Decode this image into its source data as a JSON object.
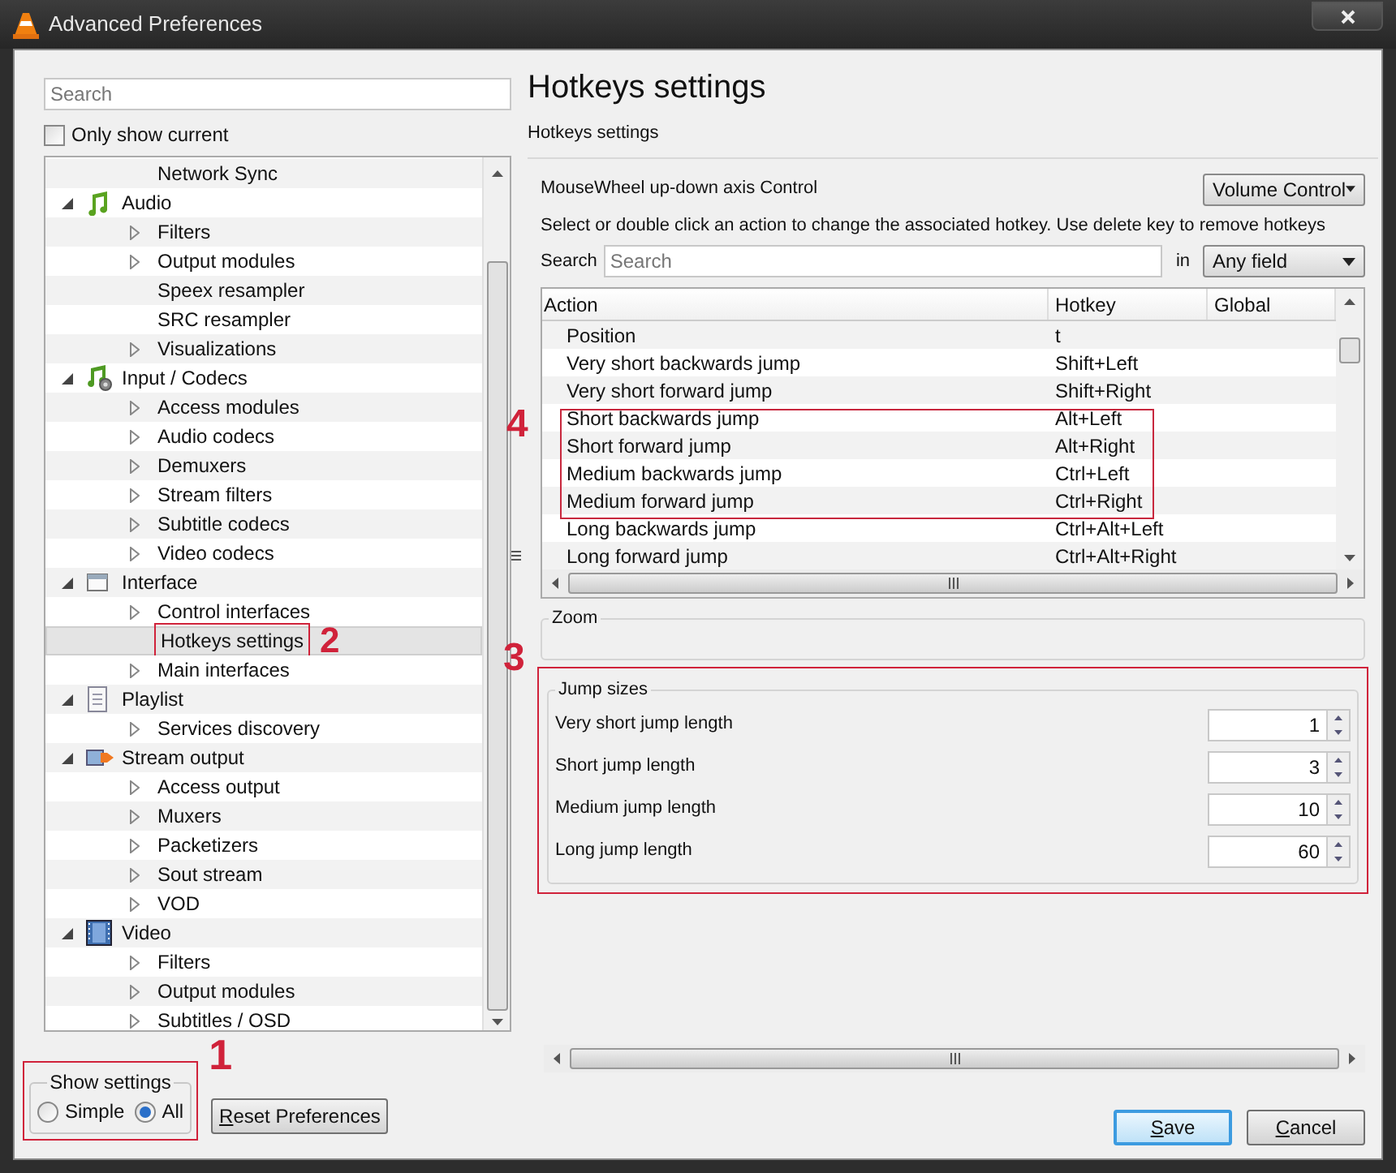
{
  "window": {
    "title": "Advanced Preferences"
  },
  "search": {
    "placeholder": "Search"
  },
  "only_show_current": {
    "label": "Only show current",
    "checked": false
  },
  "tree": {
    "continued_children": [
      {
        "label": "Network Sync",
        "expandable": false,
        "selected": false
      }
    ],
    "items": [
      {
        "label": "Audio",
        "kind": "audio",
        "expanded": true,
        "children": [
          {
            "label": "Filters",
            "expandable": true,
            "selected": false
          },
          {
            "label": "Output modules",
            "expandable": true,
            "selected": false
          },
          {
            "label": "Speex resampler",
            "expandable": false,
            "selected": false
          },
          {
            "label": "SRC resampler",
            "expandable": false,
            "selected": false
          },
          {
            "label": "Visualizations",
            "expandable": true,
            "selected": false
          }
        ]
      },
      {
        "label": "Input / Codecs",
        "kind": "codecs",
        "expanded": true,
        "children": [
          {
            "label": "Access modules",
            "expandable": true,
            "selected": false
          },
          {
            "label": "Audio codecs",
            "expandable": true,
            "selected": false
          },
          {
            "label": "Demuxers",
            "expandable": true,
            "selected": false
          },
          {
            "label": "Stream filters",
            "expandable": true,
            "selected": false
          },
          {
            "label": "Subtitle codecs",
            "expandable": true,
            "selected": false
          },
          {
            "label": "Video codecs",
            "expandable": true,
            "selected": false
          }
        ]
      },
      {
        "label": "Interface",
        "kind": "interface",
        "expanded": true,
        "children": [
          {
            "label": "Control interfaces",
            "expandable": true,
            "selected": false
          },
          {
            "label": "Hotkeys settings",
            "expandable": false,
            "selected": true,
            "annotation": "2"
          },
          {
            "label": "Main interfaces",
            "expandable": true,
            "selected": false
          }
        ]
      },
      {
        "label": "Playlist",
        "kind": "playlist",
        "expanded": true,
        "children": [
          {
            "label": "Services discovery",
            "expandable": true,
            "selected": false
          }
        ]
      },
      {
        "label": "Stream output",
        "kind": "stream",
        "expanded": true,
        "children": [
          {
            "label": "Access output",
            "expandable": true,
            "selected": false
          },
          {
            "label": "Muxers",
            "expandable": true,
            "selected": false
          },
          {
            "label": "Packetizers",
            "expandable": true,
            "selected": false
          },
          {
            "label": "Sout stream",
            "expandable": true,
            "selected": false
          },
          {
            "label": "VOD",
            "expandable": true,
            "selected": false
          }
        ]
      },
      {
        "label": "Video",
        "kind": "video",
        "expanded": true,
        "children": [
          {
            "label": "Filters",
            "expandable": true,
            "selected": false
          },
          {
            "label": "Output modules",
            "expandable": true,
            "selected": false
          },
          {
            "label": "Subtitles / OSD",
            "expandable": true,
            "selected": false
          }
        ]
      }
    ]
  },
  "show_settings": {
    "title": "Show settings",
    "annotation": "1",
    "options": [
      {
        "label": "Simple",
        "selected": false
      },
      {
        "label": "All",
        "selected": true
      }
    ]
  },
  "reset_button": "Reset Preferences",
  "page_title": "Hotkeys settings",
  "section_title": "Hotkeys settings",
  "mousewheel": {
    "label": "MouseWheel up-down axis Control",
    "value": "Volume Control"
  },
  "instructions": "Select or double click an action to change the associated hotkey. Use delete key to remove hotkeys",
  "hotkey_search": {
    "label": "Search",
    "placeholder": "Search",
    "in_label": "in",
    "field": "Any field"
  },
  "table": {
    "annotation": "4",
    "columns": [
      "Action",
      "Hotkey",
      "Global"
    ],
    "rows": [
      {
        "action": "Position",
        "hotkey": "t",
        "marked": false
      },
      {
        "action": "Very short backwards jump",
        "hotkey": "Shift+Left",
        "marked": false
      },
      {
        "action": "Very short forward jump",
        "hotkey": "Shift+Right",
        "marked": false
      },
      {
        "action": "Short backwards jump",
        "hotkey": "Alt+Left",
        "marked": true
      },
      {
        "action": "Short forward jump",
        "hotkey": "Alt+Right",
        "marked": true
      },
      {
        "action": "Medium backwards jump",
        "hotkey": "Ctrl+Left",
        "marked": true
      },
      {
        "action": "Medium forward jump",
        "hotkey": "Ctrl+Right",
        "marked": true
      },
      {
        "action": "Long backwards jump",
        "hotkey": "Ctrl+Alt+Left",
        "marked": false
      },
      {
        "action": "Long forward jump",
        "hotkey": "Ctrl+Alt+Right",
        "marked": false
      }
    ]
  },
  "zoom_group": {
    "title": "Zoom"
  },
  "jump_sizes": {
    "title": "Jump sizes",
    "annotation": "3",
    "fields": [
      {
        "label": "Very short jump length",
        "value": "1"
      },
      {
        "label": "Short jump length",
        "value": "3"
      },
      {
        "label": "Medium jump length",
        "value": "10"
      },
      {
        "label": "Long jump length",
        "value": "60"
      }
    ]
  },
  "buttons": [
    {
      "label": "Save",
      "default": true
    },
    {
      "label": "Cancel",
      "default": false
    }
  ]
}
